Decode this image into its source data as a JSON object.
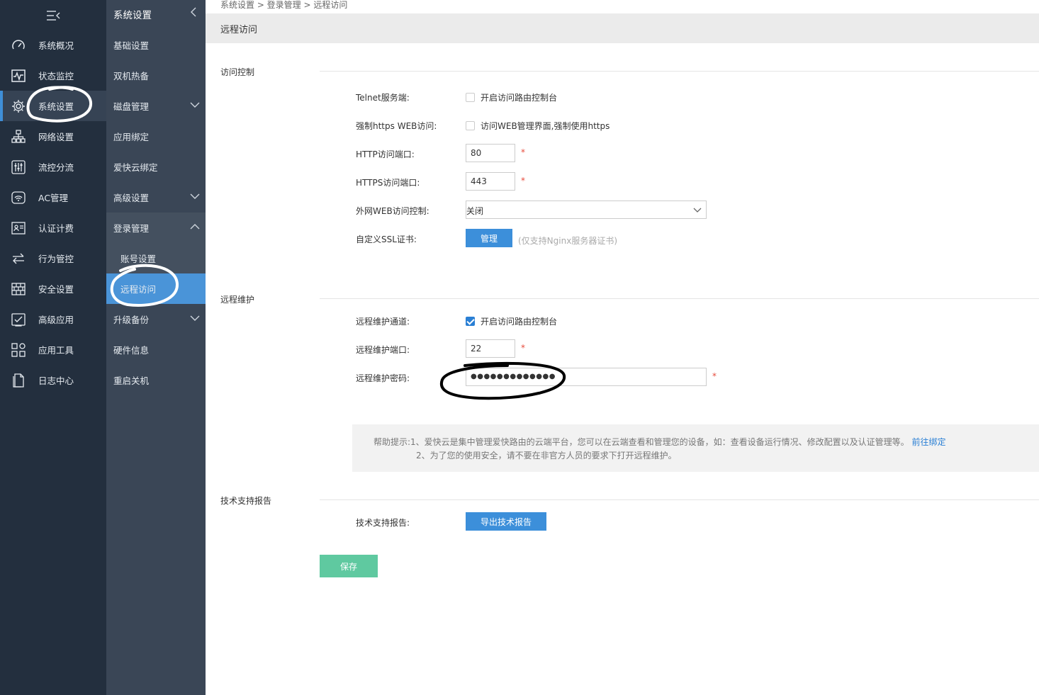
{
  "sidebar": {
    "items": [
      {
        "label": "系统概况",
        "icon": "gauge-icon"
      },
      {
        "label": "状态监控",
        "icon": "pulse-icon"
      },
      {
        "label": "系统设置",
        "icon": "gear-icon"
      },
      {
        "label": "网络设置",
        "icon": "network-icon"
      },
      {
        "label": "流控分流",
        "icon": "sliders-icon"
      },
      {
        "label": "AC管理",
        "icon": "wifi-icon"
      },
      {
        "label": "认证计费",
        "icon": "id-card-icon"
      },
      {
        "label": "行为管控",
        "icon": "arrows-icon"
      },
      {
        "label": "安全设置",
        "icon": "firewall-icon"
      },
      {
        "label": "高级应用",
        "icon": "check-window-icon"
      },
      {
        "label": "应用工具",
        "icon": "apps-icon"
      },
      {
        "label": "日志中心",
        "icon": "document-icon"
      }
    ]
  },
  "subnav": {
    "title": "系统设置",
    "items": [
      {
        "label": "基础设置"
      },
      {
        "label": "双机热备"
      },
      {
        "label": "磁盘管理"
      },
      {
        "label": "应用绑定"
      },
      {
        "label": "爱快云绑定"
      },
      {
        "label": "高级设置"
      },
      {
        "label": "登录管理"
      },
      {
        "label": "账号设置"
      },
      {
        "label": "远程访问"
      },
      {
        "label": "升级备份"
      },
      {
        "label": "硬件信息"
      },
      {
        "label": "重启关机"
      }
    ]
  },
  "breadcrumb": "系统设置 > 登录管理 > 远程访问",
  "page_title": "远程访问",
  "access": {
    "section_title": "访问控制",
    "telnet_label": "Telnet服务端:",
    "telnet_text": "开启访问路由控制台",
    "telnet_checked": false,
    "https_label": "强制https WEB访问:",
    "https_text": "访问WEB管理界面,强制使用https",
    "https_checked": false,
    "http_port_label": "HTTP访问端口:",
    "http_port": "80",
    "https_port_label": "HTTPS访问端口:",
    "https_port": "443",
    "wan_label": "外网WEB访问控制:",
    "wan_value": "关闭",
    "ssl_label": "自定义SSL证书:",
    "ssl_button": "管理",
    "ssl_hint": "(仅支持Nginx服务器证书)"
  },
  "remote": {
    "section_title": "远程维护",
    "channel_label": "远程维护通道:",
    "channel_text": "开启访问路由控制台",
    "channel_checked": true,
    "port_label": "远程维护端口:",
    "port": "22",
    "password_label": "远程维护密码:",
    "password": "●●●●●●●●●●●●●"
  },
  "help": {
    "line1": "帮助提示:1、爱快云是集中管理爱快路由的云端平台，您可以在云端查看和管理您的设备，如：查看设备运行情况、修改配置以及认证管理等。",
    "link": "前往绑定",
    "line2": "2、为了您的使用安全，请不要在非官方人员的要求下打开远程维护。"
  },
  "support": {
    "section_title": "技术支持报告",
    "label": "技术支持报告:",
    "button": "导出技术报告"
  },
  "save_label": "保存",
  "required_mark": "*",
  "colors": {
    "sidebar_bg": "#232f3e",
    "subnav_bg": "#3a4656",
    "active_blue": "#4a94d8",
    "save_green": "#5fc9a0"
  }
}
